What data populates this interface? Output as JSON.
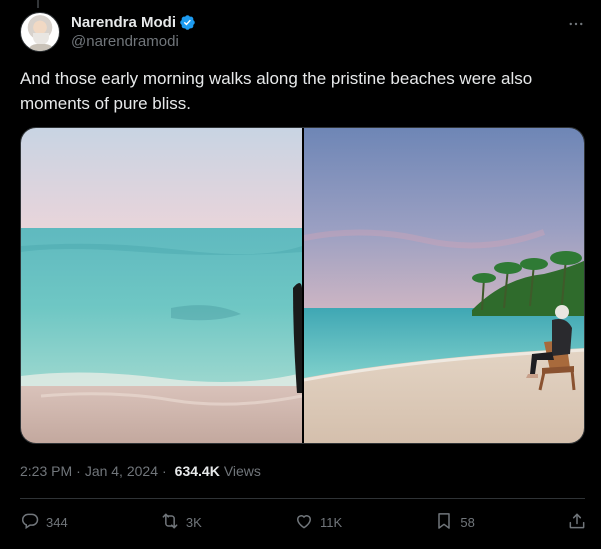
{
  "author": {
    "display_name": "Narendra Modi",
    "handle": "@narendramodi",
    "verified_color": "#1d9bf0"
  },
  "tweet": {
    "text": "And those early morning walks along the pristine beaches were also moments of pure bliss."
  },
  "media": {
    "photos": [
      {
        "icon": "beach-sea-photo"
      },
      {
        "icon": "beach-sitting-photo"
      }
    ]
  },
  "meta": {
    "time": "2:23 PM",
    "separator": "·",
    "date": "Jan 4, 2024",
    "views_count": "634.4K",
    "views_label": "Views"
  },
  "actions": {
    "replies": "344",
    "reposts": "3K",
    "likes": "11K",
    "bookmarks": "58"
  },
  "colors": {
    "background": "#000000",
    "text": "#e7e9ea",
    "secondary": "#71767b",
    "border": "#2f3336"
  }
}
